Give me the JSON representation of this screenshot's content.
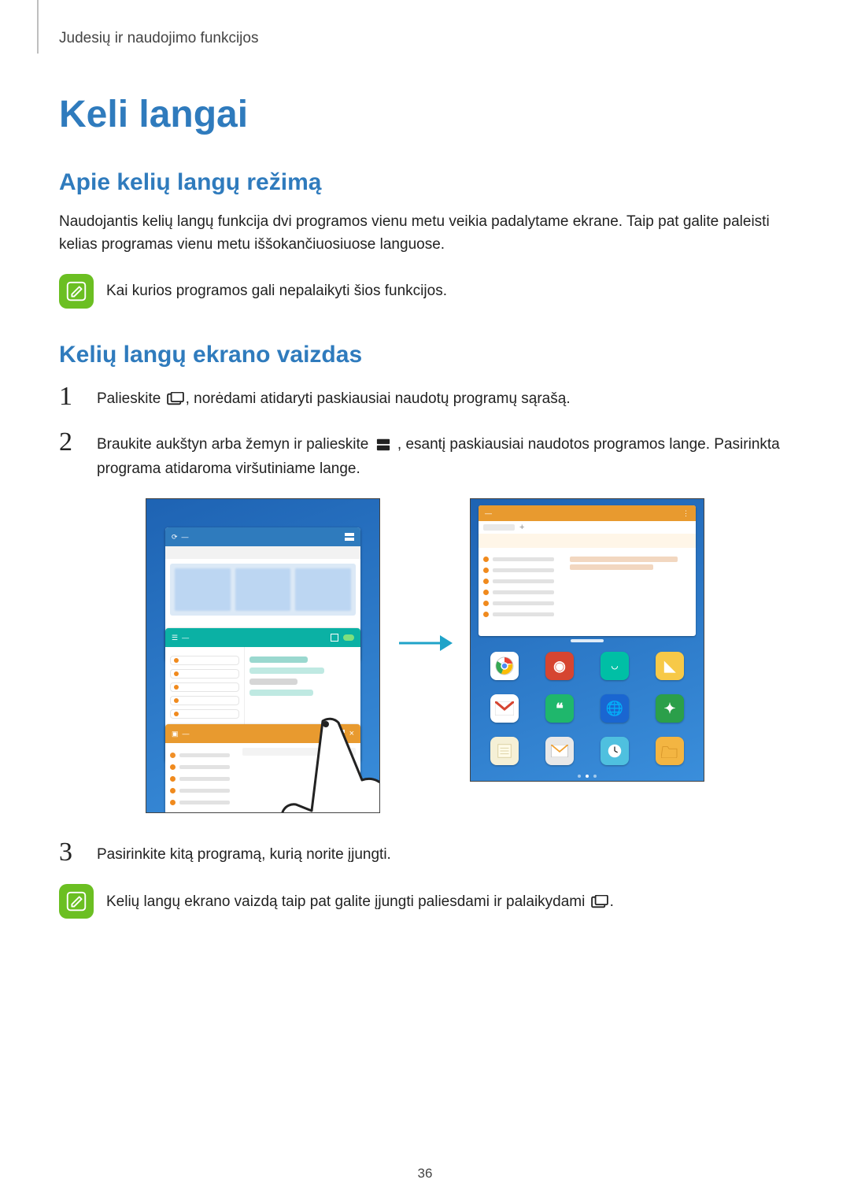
{
  "runningHead": "Judesių ir naudojimo funkcijos",
  "title": "Keli langai",
  "section1": {
    "heading": "Apie kelių langų režimą",
    "body": "Naudojantis kelių langų funkcija dvi programos vienu metu veikia padalytame ekrane. Taip pat galite paleisti kelias programas vienu metu iššokančiuosiuose languose."
  },
  "note1": "Kai kurios programos gali nepalaikyti šios funkcijos.",
  "section2": {
    "heading": "Kelių langų ekrano vaizdas"
  },
  "steps": {
    "s1_pre": "Palieskite ",
    "s1_post": ", norėdami atidaryti paskiausiai naudotų programų sąrašą.",
    "s2_pre": "Braukite aukštyn arba žemyn ir palieskite ",
    "s2_mid": ", esantį paskiausiai naudotos programos lange. Pasirinkta programa atidaroma viršutiniame lange.",
    "s3": "Pasirinkite kitą programą, kurią norite įjungti."
  },
  "note2_pre": "Kelių langų ekrano vaizdą taip pat galite įjungti paliesdami ir palaikydami ",
  "note2_post": ".",
  "pageNumber": "36",
  "icons": {
    "note": "note-pencil-icon",
    "recent": "recent-apps-icon",
    "multiwindow": "multiwindow-icon"
  }
}
